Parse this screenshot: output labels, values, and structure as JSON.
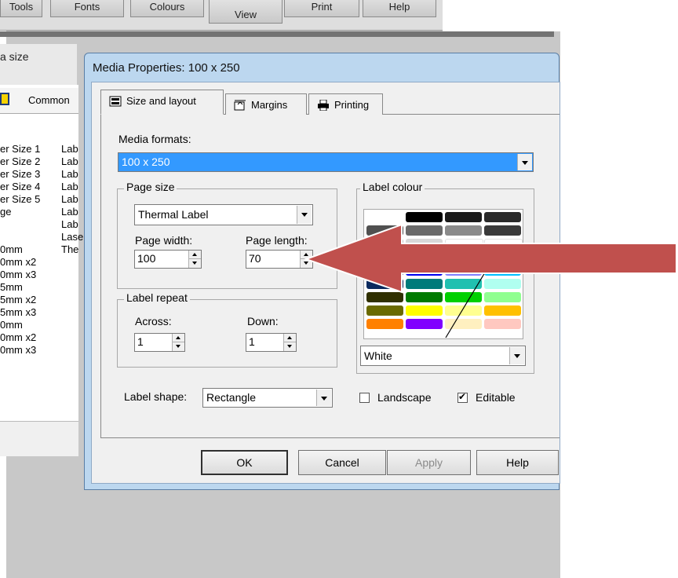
{
  "background_app": {
    "toolbar_buttons": [
      "Tools",
      "Fonts",
      "Colours",
      "View",
      "Print",
      "Help"
    ],
    "panel_title": "a size",
    "panel_tab": "Common",
    "list_col1": [
      "er Size 1",
      "er Size 2",
      "er Size 3",
      "er Size 4",
      "er Size 5",
      "ge",
      "",
      "0mm",
      "0mm x2",
      "0mm x3",
      "5mm",
      "5mm x2",
      "5mm x3",
      "0mm",
      "0mm x2",
      "0mm x3"
    ],
    "list_col2": [
      "Lab",
      "Lab",
      "Lab",
      "Lab",
      "Lab",
      "Lab",
      "Lab",
      "Lase",
      "The"
    ]
  },
  "dialog": {
    "title": "Media Properties: 100 x 250",
    "tabs": [
      {
        "label": "Size and layout",
        "icon": "layout-icon",
        "active": true
      },
      {
        "label": "Margins",
        "icon": "margins-icon",
        "active": false
      },
      {
        "label": "Printing",
        "icon": "printer-icon",
        "active": false
      }
    ],
    "media_formats": {
      "label": "Media formats:",
      "value": "100 x 250"
    },
    "page_size": {
      "group_label": "Page size",
      "type_value": "Thermal Label",
      "width_label": "Page width:",
      "width_value": "100",
      "length_label": "Page length:",
      "length_value": "70"
    },
    "label_repeat": {
      "group_label": "Label repeat",
      "across_label": "Across:",
      "across_value": "1",
      "down_label": "Down:",
      "down_value": "1"
    },
    "label_colour": {
      "group_label": "Label colour",
      "selected": "White",
      "swatches": [
        [
          "none",
          "#000000",
          "#1a1a1a",
          "#2a2a2a"
        ],
        [
          "#505050",
          "#6a6a6a",
          "#8a8a8a",
          "#3a3a3a"
        ],
        [
          "#c0c0c0",
          "#d8d8d8",
          "#ffffff",
          "#ffffff"
        ],
        [
          "#ffffff",
          "#ffffff",
          "#ffffff",
          "#ffffff"
        ],
        [
          "#0a0a6e",
          "#0000ee",
          "#8080ff",
          "#00c0ff"
        ],
        [
          "#0a2a5e",
          "#007a7a",
          "#20c0b0",
          "#b0fff0"
        ],
        [
          "#303000",
          "#007a00",
          "#00d000",
          "#90ff90"
        ],
        [
          "#6a6a00",
          "#ffff00",
          "#ffff90",
          "#ffc000"
        ],
        [
          "#ff8000",
          "#8000ff",
          "#fff0c0",
          "#ffc8c0"
        ]
      ]
    },
    "label_shape": {
      "label": "Label shape:",
      "value": "Rectangle"
    },
    "landscape": {
      "label": "Landscape",
      "checked": false
    },
    "editable": {
      "label": "Editable",
      "checked": true
    },
    "buttons": {
      "ok": "OK",
      "cancel": "Cancel",
      "apply": "Apply",
      "help": "Help"
    }
  },
  "colors": {
    "arrow": "#c0504d",
    "title_bar": "#bcd7ef",
    "selection": "#3399ff"
  }
}
